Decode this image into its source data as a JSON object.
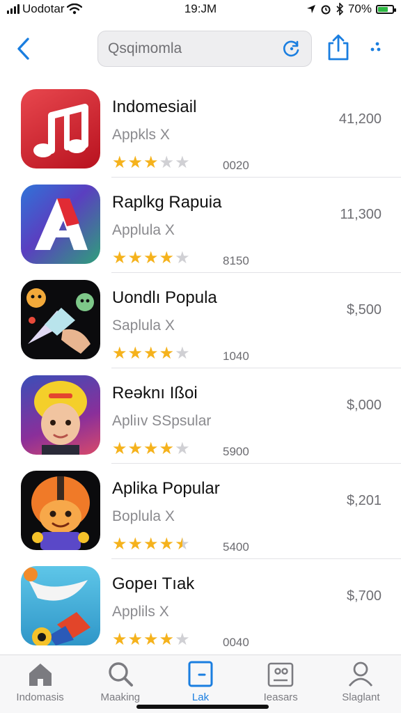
{
  "status_bar": {
    "carrier": "Uodotar",
    "time": "19:JM",
    "battery": "70%",
    "battery_level": 0.7
  },
  "nav": {
    "back_icon": "chevron-left-icon",
    "search_text": "Qsqimomla",
    "refresh_icon": "refresh-icon",
    "share_icon": "share-icon",
    "more_icon": "more-icon",
    "accent": "#1a7ee0"
  },
  "apps": [
    {
      "name": "Indomesiail",
      "subtitle": "Appkls X",
      "rating": 3,
      "reviews": "0020",
      "price": "41,200"
    },
    {
      "name": "Raplkg Rapuia",
      "subtitle": "Applula X",
      "rating": 4,
      "reviews": "8150",
      "price": "11,300"
    },
    {
      "name": "Uondlı Popula",
      "subtitle": "Saplula X",
      "rating": 4,
      "reviews": "1040",
      "price": "$,500"
    },
    {
      "name": "Reǝknı Ißoi",
      "subtitle": "Apliıv SSpsular",
      "rating": 4,
      "reviews": "5900",
      "price": "$,000"
    },
    {
      "name": "Aplika Popular",
      "subtitle": "Boplula X",
      "rating": 4.5,
      "reviews": "5400",
      "price": "$,201"
    },
    {
      "name": "Gopeı Tıak",
      "subtitle": "Applils X",
      "rating": 4,
      "reviews": "0040",
      "price": "$,700"
    }
  ],
  "tabs": [
    {
      "label": "Indomasis",
      "icon": "home-icon"
    },
    {
      "label": "Maaking",
      "icon": "search-icon"
    },
    {
      "label": "Lak",
      "icon": "library-icon"
    },
    {
      "label": "Ieasars",
      "icon": "games-icon"
    },
    {
      "label": "Slaglant",
      "icon": "profile-icon"
    }
  ],
  "colors": {
    "star": "#f5b21c",
    "tab_active": "#1a7ee0"
  }
}
